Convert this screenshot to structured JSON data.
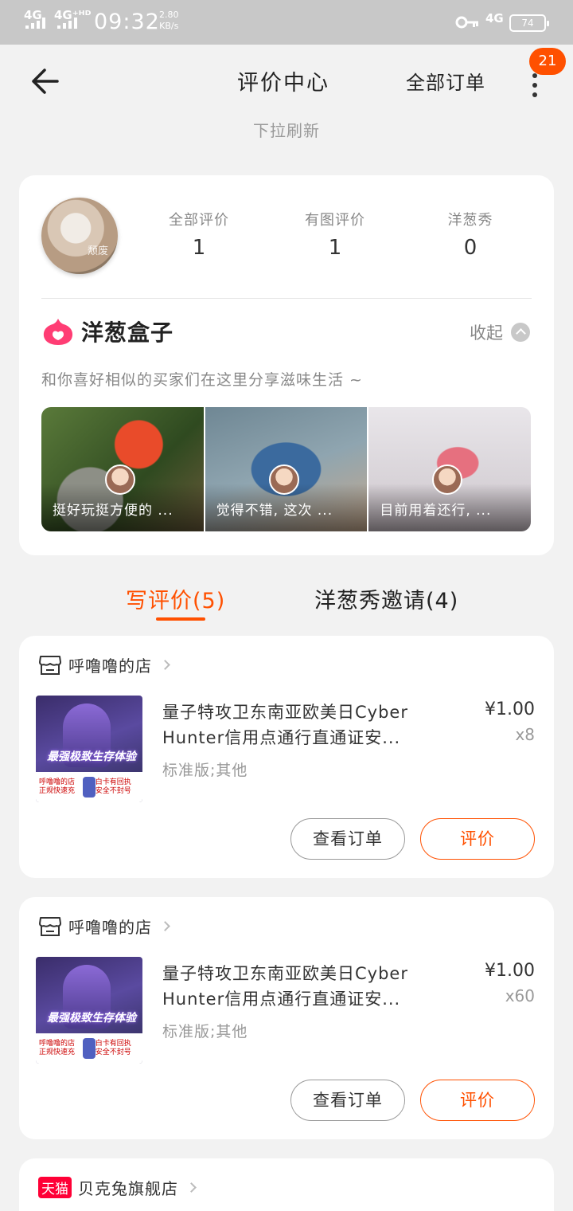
{
  "status_bar": {
    "network_1": "4G",
    "network_2": "4G⁺ᴴᴰ",
    "time": "09:32",
    "speed_value": "2.80",
    "speed_unit": "KB/s",
    "network_3": "4G",
    "battery": "74"
  },
  "header": {
    "title": "评价中心",
    "all_orders": "全部订单",
    "badge_count": "21"
  },
  "pull_refresh": "下拉刷新",
  "profile": {
    "avatar_watermark": "颓废",
    "stats": [
      {
        "label": "全部评价",
        "value": "1"
      },
      {
        "label": "有图评价",
        "value": "1"
      },
      {
        "label": "洋葱秀",
        "value": "0"
      }
    ]
  },
  "onion_box": {
    "title": "洋葱盒子",
    "collapse_label": "收起",
    "description": "和你喜好相似的买家们在这里分享滋味生活 ~",
    "gallery": [
      {
        "caption": "挺好玩挺方便的 ..."
      },
      {
        "caption": "觉得不错, 这次 ..."
      },
      {
        "caption": "目前用着还行, ..."
      }
    ]
  },
  "tabs": {
    "write_review": "写评价(5)",
    "onion_invite": "洋葱秀邀请(4)"
  },
  "orders": [
    {
      "shop_name": "呼噜噜的店",
      "product_title": "量子特攻卫东南亚欧美日Cyber Hunter信用点通行直通证安...",
      "sku": "标准版;其他",
      "price": "¥1.00",
      "quantity": "x8",
      "thumb_banner": "最强极致生存体验",
      "thumb_left": "呼噜噜的店 正规快速充",
      "thumb_right": "白卡有回执 安全不封号",
      "view_order_label": "查看订单",
      "review_label": "评价"
    },
    {
      "shop_name": "呼噜噜的店",
      "product_title": "量子特攻卫东南亚欧美日Cyber Hunter信用点通行直通证安...",
      "sku": "标准版;其他",
      "price": "¥1.00",
      "quantity": "x60",
      "thumb_banner": "最强极致生存体验",
      "thumb_left": "呼噜噜的店 正规快速充",
      "thumb_right": "白卡有回执 安全不封号",
      "view_order_label": "查看订单",
      "review_label": "评价"
    }
  ],
  "third_shop": {
    "badge": "天猫",
    "name": "贝克兔旗舰店"
  },
  "colors": {
    "accent": "#ff5000",
    "tmall": "#ff0036",
    "background": "#f2f2f2"
  }
}
